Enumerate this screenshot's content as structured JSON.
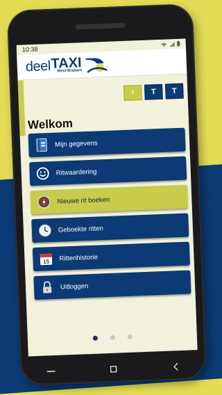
{
  "status_bar": {
    "time": "10:38"
  },
  "app": {
    "logo_deel": "deel",
    "logo_taxi": "TAXI",
    "logo_region": "West-Brabant"
  },
  "text_size": {
    "buttons": [
      "T",
      "T",
      "T"
    ],
    "active_index": 0
  },
  "welcome": "Welkom",
  "menu": [
    {
      "label": "Mijn gegevens",
      "icon": "address-book-icon"
    },
    {
      "label": "Ritwaardering",
      "icon": "smiley-icon"
    },
    {
      "label": "Nieuwe rit boeken",
      "icon": "compass-icon",
      "highlighted": true
    },
    {
      "label": "Geboekte ritten",
      "icon": "clock-icon"
    },
    {
      "label": "Rittenhistorie",
      "icon": "calendar-icon",
      "calendar_day": "15"
    },
    {
      "label": "Uitloggen",
      "icon": "lock-icon"
    }
  ],
  "pager": {
    "count": 3,
    "active": 0
  },
  "colors": {
    "navy": "#0b3a75",
    "lime": "#c7cc4a",
    "background_yellow": "#e3dc55"
  }
}
